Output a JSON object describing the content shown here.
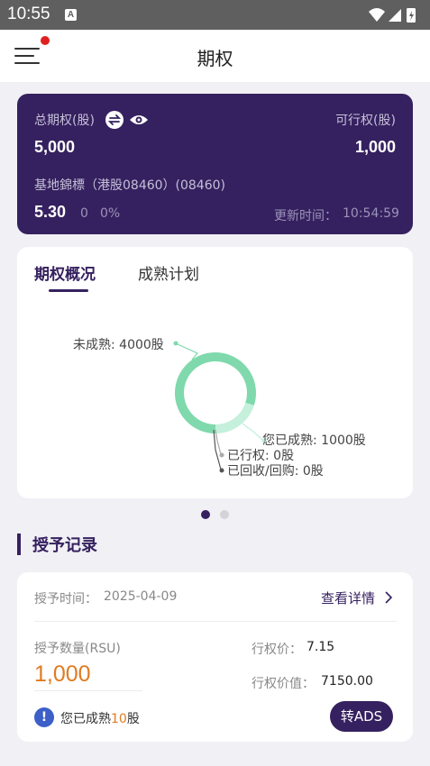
{
  "status_bar": {
    "time": "10:55",
    "notification_icon_letter": "A"
  },
  "app_bar": {
    "title": "期权"
  },
  "summary": {
    "total_label": "总期权(股)",
    "total_value": "5,000",
    "exercisable_label": "可行权(股)",
    "exercisable_value": "1,000",
    "stock_name": "基地錦標（港股08460）(08460)",
    "price": "5.30",
    "change": "0",
    "change_pct": "0%",
    "update_time_label": "更新时间：",
    "update_time": "10:54:59"
  },
  "overview": {
    "tabs": [
      {
        "label": "期权概况",
        "active": true
      },
      {
        "label": "成熟计划",
        "active": false
      }
    ]
  },
  "chart_data": {
    "type": "pie",
    "slices": [
      {
        "label": "未成熟: 4000股",
        "value": 4000,
        "color": "#7fd9ac"
      },
      {
        "label": "您已成熟: 1000股",
        "value": 1000,
        "color": "#c4f0dc"
      },
      {
        "label": "已行权: 0股",
        "value": 0,
        "color": "#aaaaaa"
      },
      {
        "label": "已回收/回购: 0股",
        "value": 0,
        "color": "#555555"
      }
    ]
  },
  "section": {
    "title": "授予记录"
  },
  "record": {
    "grant_time_label": "授予时间：",
    "grant_time": "2025-04-09",
    "detail_link": "查看详情",
    "qty_label": "授予数量(RSU)",
    "qty_value": "1,000",
    "strike_label": "行权价：",
    "strike_value": "7.15",
    "value_label": "行权价值：",
    "value_value": "7150.00",
    "vested_prefix": "您已成熟",
    "vested_count": "10",
    "vested_suffix": "股",
    "action_button": "转ADS"
  },
  "colors": {
    "brand": "#35215f",
    "accent_orange": "#e07b20",
    "info_blue": "#3c5fc8"
  }
}
